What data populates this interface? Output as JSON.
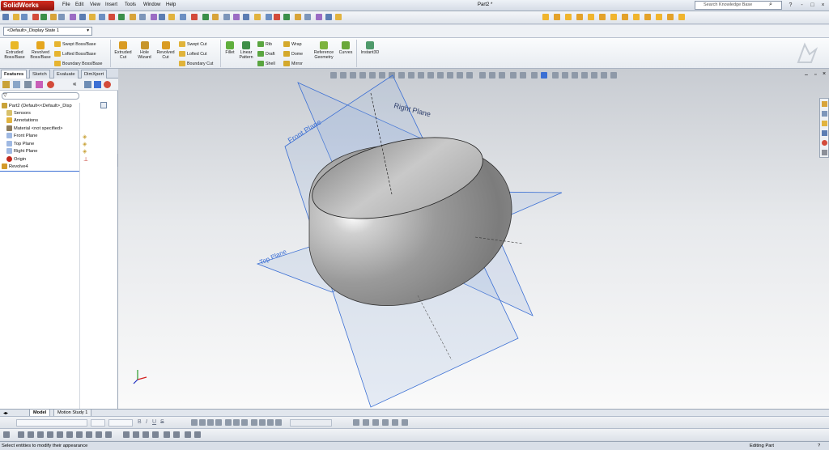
{
  "app": {
    "logo": "SolidWorks",
    "document_title": "Part2 *"
  },
  "menu": [
    "File",
    "Edit",
    "View",
    "Insert",
    "Tools",
    "Window",
    "Help"
  ],
  "search": {
    "placeholder": "Search Knowledge Base"
  },
  "window_controls": [
    "?",
    "-",
    "□",
    "×"
  ],
  "config_dropdown": {
    "value": "<Default>_Display State 1"
  },
  "command_manager": {
    "extruded_boss": "Extruded Boss/Base",
    "revolved_boss": "Revolved Boss/Base",
    "swept_boss": "Swept Boss/Base",
    "lofted_boss": "Lofted Boss/Base",
    "boundary_boss": "Boundary Boss/Base",
    "extruded_cut": "Extruded Cut",
    "hole_wizard": "Hole Wizard",
    "revolved_cut": "Revolved Cut",
    "swept_cut": "Swept Cut",
    "lofted_cut": "Lofted Cut",
    "boundary_cut": "Boundary Cut",
    "fillet": "Fillet",
    "linear_pattern": "Linear Pattern",
    "rib": "Rib",
    "draft": "Draft",
    "shell": "Shell",
    "wrap": "Wrap",
    "dome": "Dome",
    "mirror": "Mirror",
    "reference_geometry": "Reference Geometry",
    "curves": "Curves",
    "instant3d": "Instant3D"
  },
  "tabs": [
    "Features",
    "Sketch",
    "Evaluate",
    "DimXpert"
  ],
  "feature_tree": {
    "root": "Part2  (Default<<Default>_Disp",
    "items": [
      "Sensors",
      "Annotations",
      "Material <not specified>",
      "Front Plane",
      "Top Plane",
      "Right Plane",
      "Origin",
      "Revolve4"
    ]
  },
  "plane_labels": {
    "front": "Front Plane",
    "right": "Right Plane",
    "top": "Top Plane"
  },
  "bottom_tabs": [
    "Model",
    "Motion Study 1"
  ],
  "status": {
    "left": "Select entities to modify their appearance",
    "right": "Editing Part",
    "help": "?"
  },
  "colors": {
    "accent_red": "#c0281c",
    "plane_blue": "#3b6fd4",
    "ui_bg": "#d6dbe3"
  }
}
